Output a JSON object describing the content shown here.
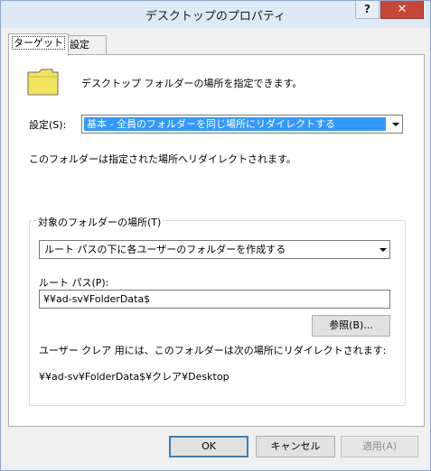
{
  "window": {
    "title": "デスクトップのプロパティ",
    "help_label": "?",
    "close_label": "✕"
  },
  "tabs": [
    {
      "label": "ターゲット",
      "active": true
    },
    {
      "label": "設定",
      "active": false
    }
  ],
  "target": {
    "description": "デスクトップ フォルダーの場所を指定できます。",
    "setting_label": "設定(S):",
    "setting_value": "基本 - 全員のフォルダーを同じ場所にリダイレクトする",
    "redirect_note": "このフォルダーは指定された場所へリダイレクトされます。",
    "group_title": "対象のフォルダーの場所(T)",
    "location_value": "ルート パスの下に各ユーザーのフォルダーを作成する",
    "root_path_label": "ルート パス(P):",
    "root_path_value": "¥¥ad-sv¥FolderData$",
    "browse_label": "参照(B)...",
    "example_label": "ユーザー クレア 用には、このフォルダーは次の場所にリダイレクトされます:",
    "example_path": "¥¥ad-sv¥FolderData$¥クレア¥Desktop"
  },
  "buttons": {
    "ok": "OK",
    "cancel": "キャンセル",
    "apply": "適用(A)"
  },
  "colors": {
    "selection": "#3399ff",
    "close_button": "#c7463a",
    "titlebar": "#dde9f6",
    "folder": "#f2e45c"
  },
  "icons": {
    "folder": "folder-icon",
    "dropdown": "chevron-down-icon"
  }
}
